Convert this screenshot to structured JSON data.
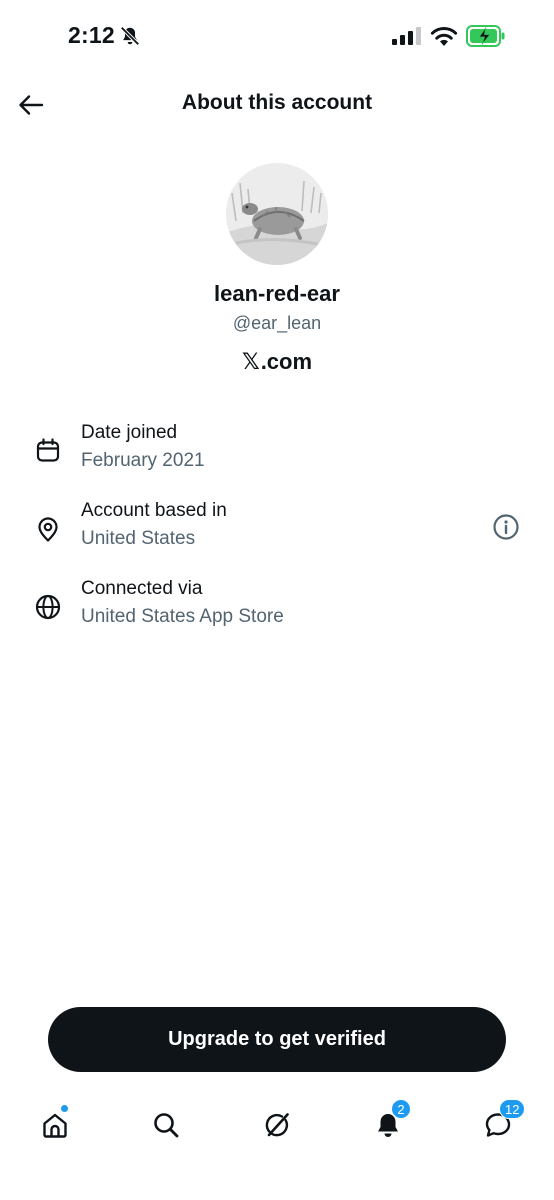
{
  "status_bar": {
    "time": "2:12"
  },
  "header": {
    "title": "About this account"
  },
  "profile": {
    "display_name": "lean-red-ear",
    "handle": "@ear_lean",
    "domain": ".com",
    "domain_logo": "𝕏"
  },
  "details": [
    {
      "icon": "calendar-icon",
      "label": "Date joined",
      "value": "February 2021"
    },
    {
      "icon": "location-pin-icon",
      "label": "Account based in",
      "value": "United States"
    },
    {
      "icon": "globe-icon",
      "label": "Connected via",
      "value": "United States App Store"
    }
  ],
  "upgrade": {
    "label": "Upgrade to get verified"
  },
  "tab_bar": {
    "notifications_badge": "2",
    "messages_badge": "12"
  },
  "colors": {
    "text_primary": "#0f1419",
    "text_secondary": "#536471",
    "accent": "#1d9bf0",
    "battery_green": "#34c759"
  }
}
